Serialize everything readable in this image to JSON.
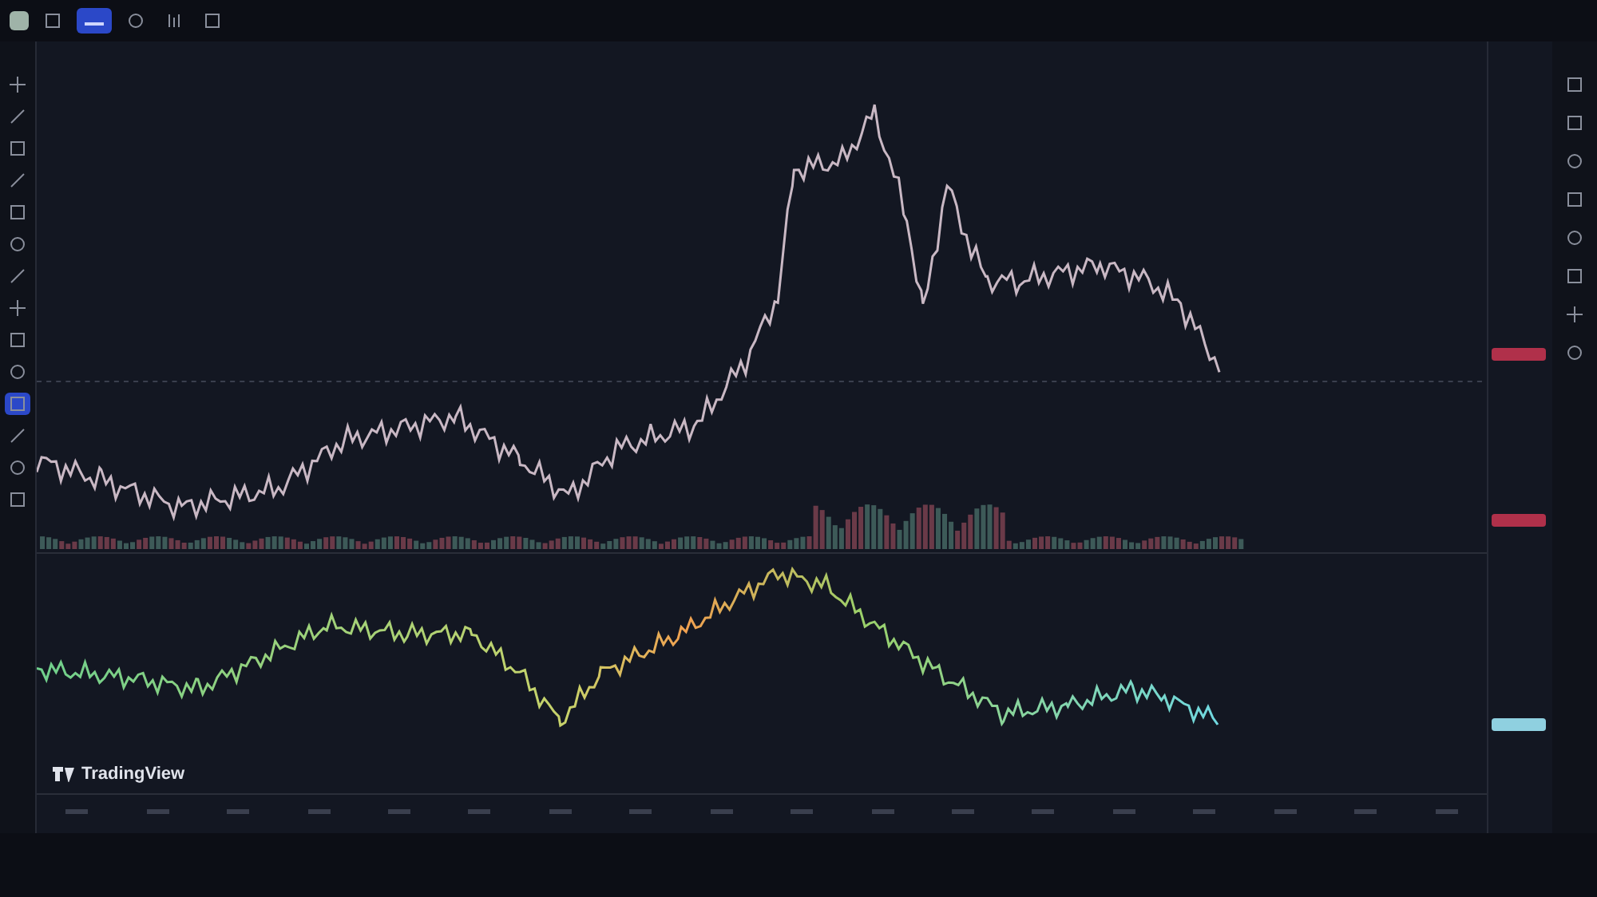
{
  "top_bar": {
    "items": [
      {
        "kind": "square",
        "selected": false
      },
      {
        "kind": "tab",
        "selected": true
      },
      {
        "kind": "circle",
        "selected": false
      },
      {
        "kind": "bars",
        "selected": false
      },
      {
        "kind": "square",
        "selected": false
      }
    ]
  },
  "left_toolbar": {
    "items": [
      {
        "kind": "cross",
        "selected": false
      },
      {
        "kind": "line",
        "selected": false
      },
      {
        "kind": "square",
        "selected": false
      },
      {
        "kind": "line",
        "selected": false
      },
      {
        "kind": "square",
        "selected": false
      },
      {
        "kind": "circle",
        "selected": false
      },
      {
        "kind": "line",
        "selected": false
      },
      {
        "kind": "cross",
        "selected": false
      },
      {
        "kind": "square",
        "selected": false
      },
      {
        "kind": "circle",
        "selected": false
      },
      {
        "kind": "square",
        "selected": true
      },
      {
        "kind": "line",
        "selected": false
      },
      {
        "kind": "circle",
        "selected": false
      },
      {
        "kind": "square",
        "selected": false
      }
    ]
  },
  "right_toolbar": {
    "items": [
      {
        "kind": "square"
      },
      {
        "kind": "square"
      },
      {
        "kind": "circle"
      },
      {
        "kind": "square"
      },
      {
        "kind": "circle"
      },
      {
        "kind": "square"
      },
      {
        "kind": "cross"
      },
      {
        "kind": "circle"
      }
    ]
  },
  "logo": {
    "text": "TradingView"
  }
}
